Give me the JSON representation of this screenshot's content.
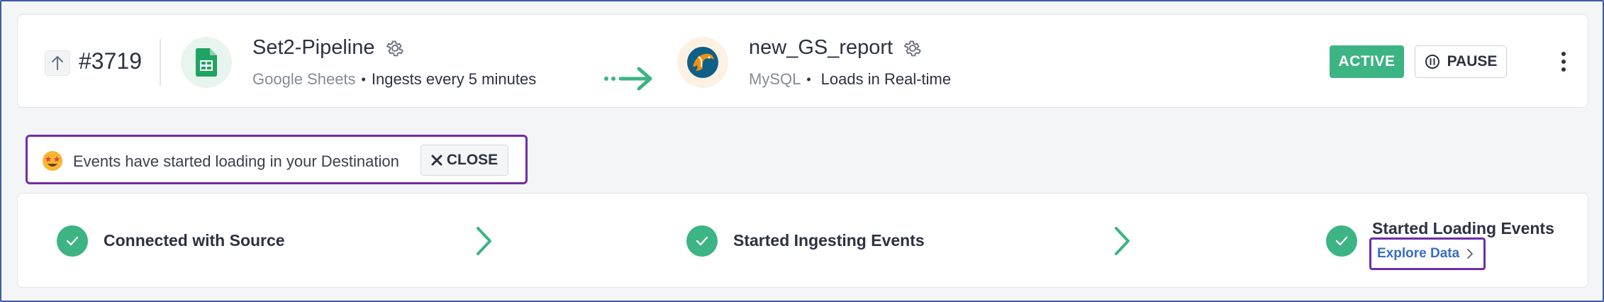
{
  "pipeline": {
    "number": "#3719",
    "source": {
      "name": "Set2-Pipeline",
      "type": "Google Sheets",
      "frequency": "Ingests every 5 minutes",
      "logo_icon": "google-sheets-icon"
    },
    "destination": {
      "name": "new_GS_report",
      "type": "MySQL",
      "frequency": "Loads in Real-time",
      "logo_icon": "mysql-dolphin-icon"
    },
    "status": "ACTIVE",
    "pause_label": "PAUSE",
    "meta_separator": "•"
  },
  "banner": {
    "emoji_icon": "star-struck-emoji-icon",
    "message": "Events have started loading in your Destination",
    "close_label": "CLOSE"
  },
  "steps": [
    {
      "label": "Connected with Source",
      "done": true
    },
    {
      "label": "Started Ingesting Events",
      "done": true
    },
    {
      "label": "Started Loading Events",
      "done": true
    }
  ],
  "explore_link": "Explore Data",
  "colors": {
    "accent_green": "#3cb483",
    "highlight_purple": "#6f2da8",
    "link_blue": "#3a6cc6",
    "text_dark": "#2d3142",
    "text_muted": "#868b99"
  }
}
